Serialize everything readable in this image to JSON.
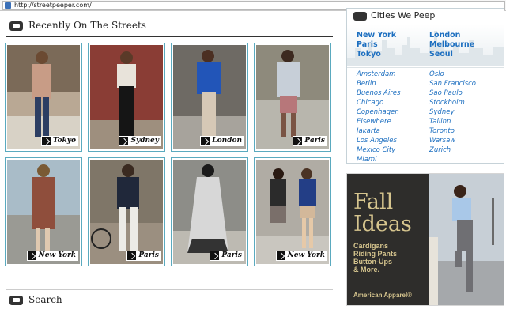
{
  "browser": {
    "url": "http://streetpeeper.com/"
  },
  "recent": {
    "title": "Recently On The Streets",
    "cards": [
      {
        "city": "Tokyo"
      },
      {
        "city": "Sydney"
      },
      {
        "city": "London"
      },
      {
        "city": "Paris"
      },
      {
        "city": "New York"
      },
      {
        "city": "Paris"
      },
      {
        "city": "Paris"
      },
      {
        "city": "New York"
      }
    ]
  },
  "search": {
    "title": "Search"
  },
  "cities": {
    "title": "Cities We Peep",
    "featured": [
      "New York",
      "London",
      "Paris",
      "Melbourne",
      "Tokyo",
      "Seoul"
    ],
    "col1": [
      "Amsterdam",
      "Berlin",
      "Buenos Aires",
      "Chicago",
      "Copenhagen",
      "Elsewhere",
      "Jakarta",
      "Los Angeles",
      "Mexico City",
      "Miami"
    ],
    "col2": [
      "Oslo",
      "San Francisco",
      "Sao Paulo",
      "Stockholm",
      "Sydney",
      "Tallinn",
      "Toronto",
      "Warsaw",
      "Zurich"
    ]
  },
  "ad": {
    "title_line1": "Fall",
    "title_line2": "Ideas",
    "items": [
      "Cardigans",
      "Riding Pants",
      "Button-Ups",
      "& More."
    ],
    "brand": "American Apparel®"
  },
  "colors": {
    "link": "#1d6fc0",
    "card_border": "#5aaabf",
    "ad_gold": "#d6c58e"
  }
}
